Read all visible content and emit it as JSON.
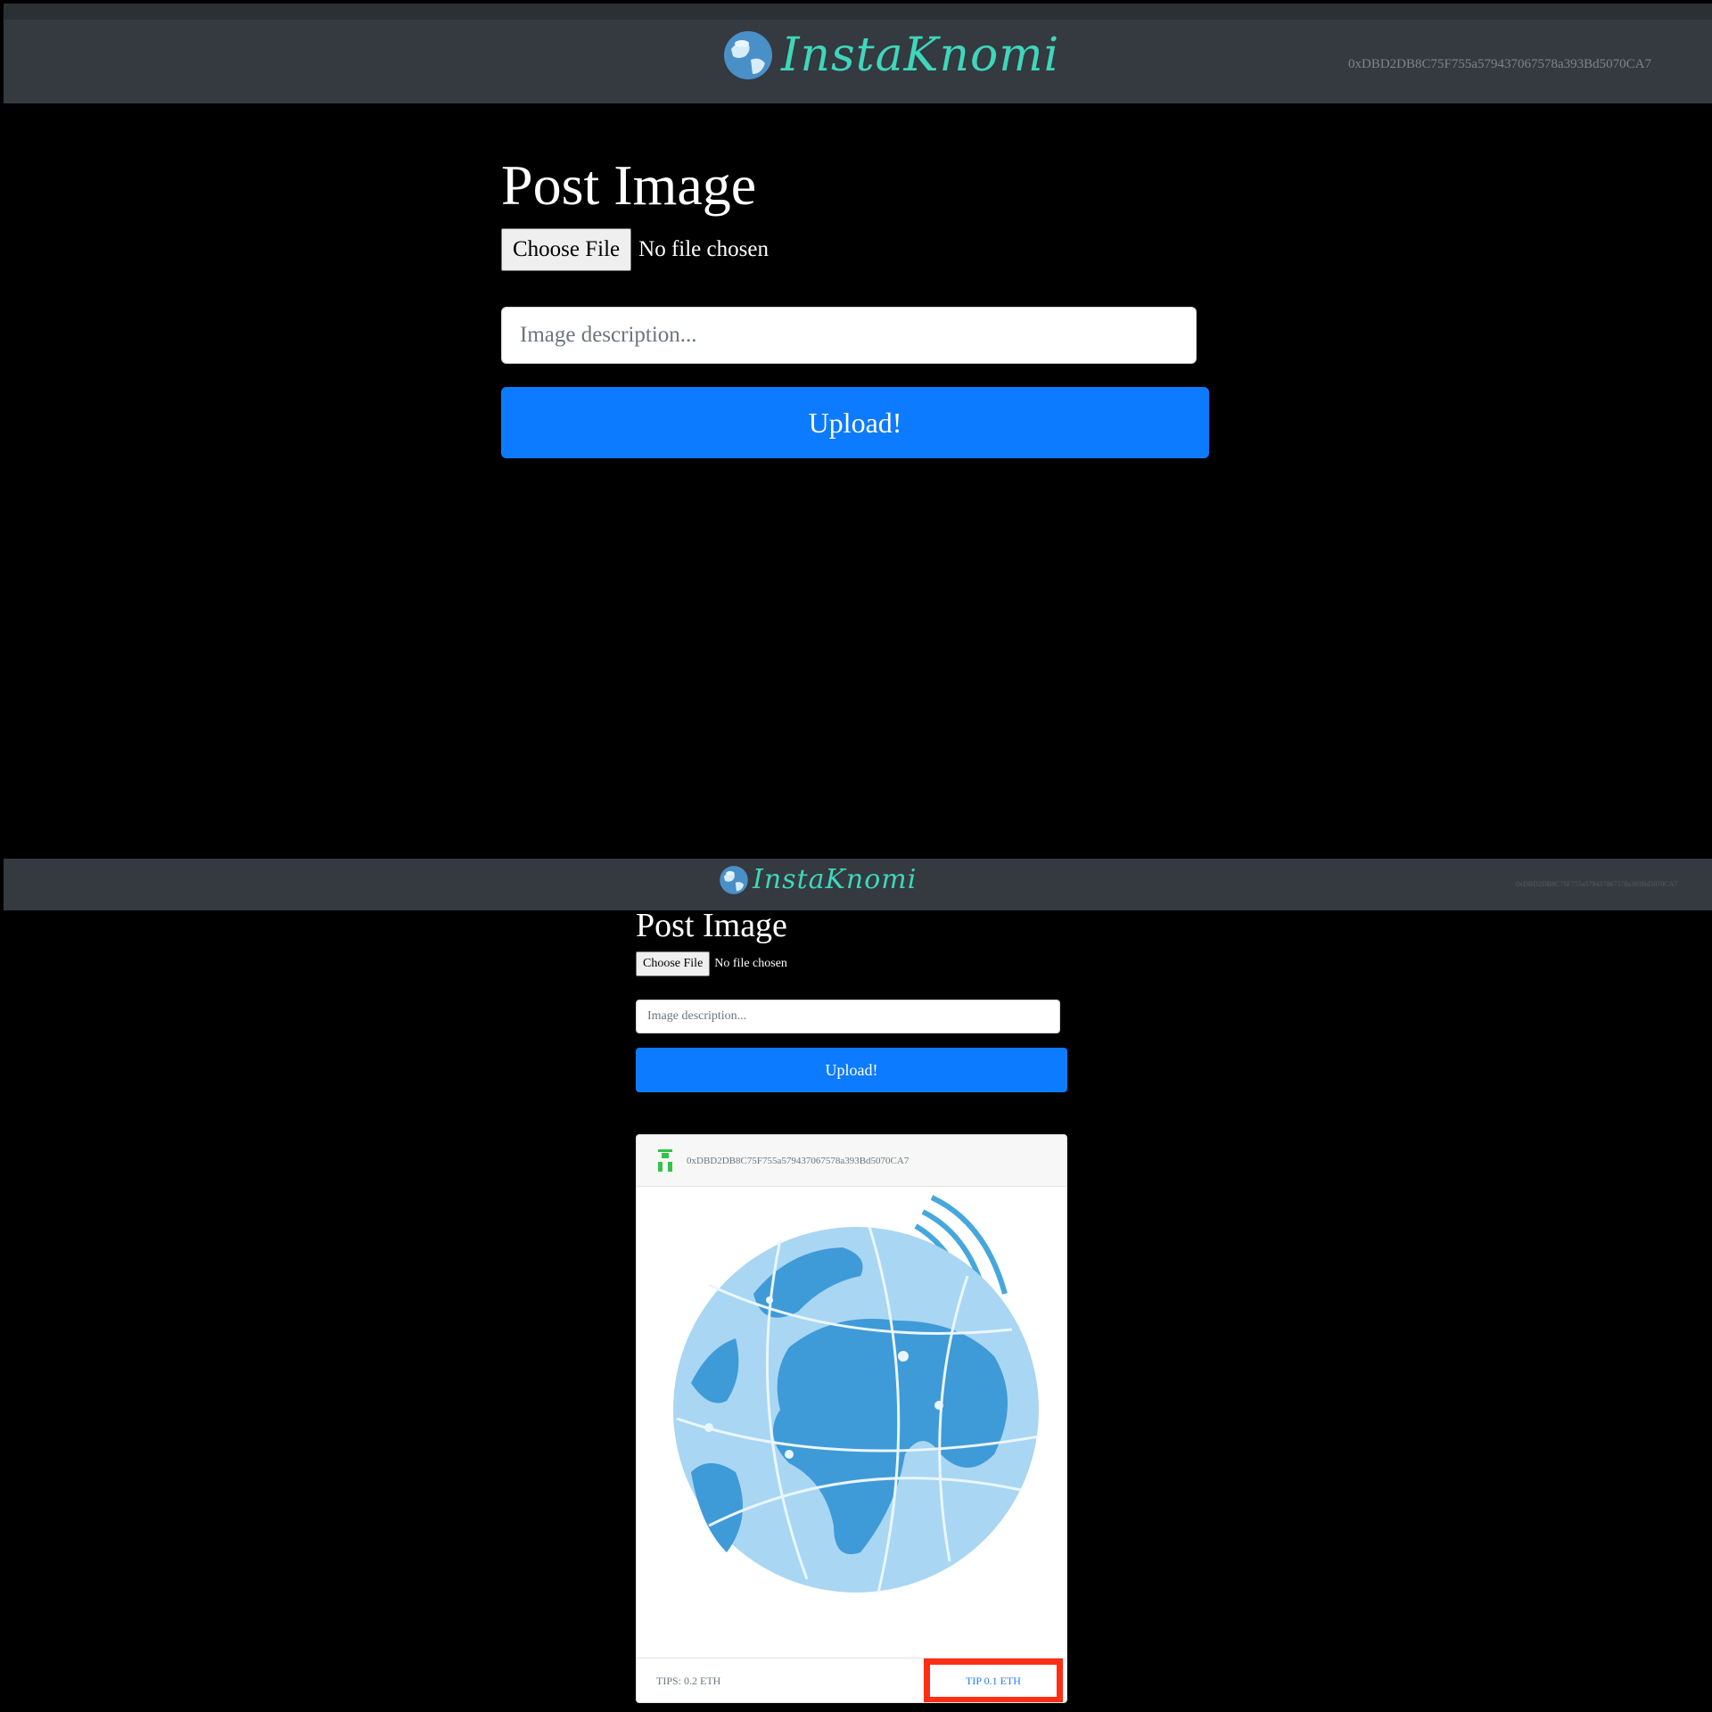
{
  "app": {
    "brand_name": "InstaKnomi",
    "account_address": "0xDBD2DB8C75F755a579437067578a393Bd5070CA7"
  },
  "form": {
    "title": "Post Image",
    "choose_file_label": "Choose File",
    "file_status": "No file chosen",
    "description_placeholder": "Image description...",
    "upload_label": "Upload!"
  },
  "post": {
    "author": "0xDBD2DB8C75F755a579437067578a393Bd5070CA7",
    "tips_label": "TIPS: 0.2 ETH",
    "tip_button_label": "TIP 0.1 ETH"
  },
  "colors": {
    "navbar": "#343a40",
    "brand_text": "#3fd6bc",
    "upload_button": "#0d7bff",
    "highlight_box": "#ff2d14"
  },
  "icons": {
    "logo": "globe-icon",
    "avatar": "identicon-avatar",
    "image": "globe-illustration"
  }
}
